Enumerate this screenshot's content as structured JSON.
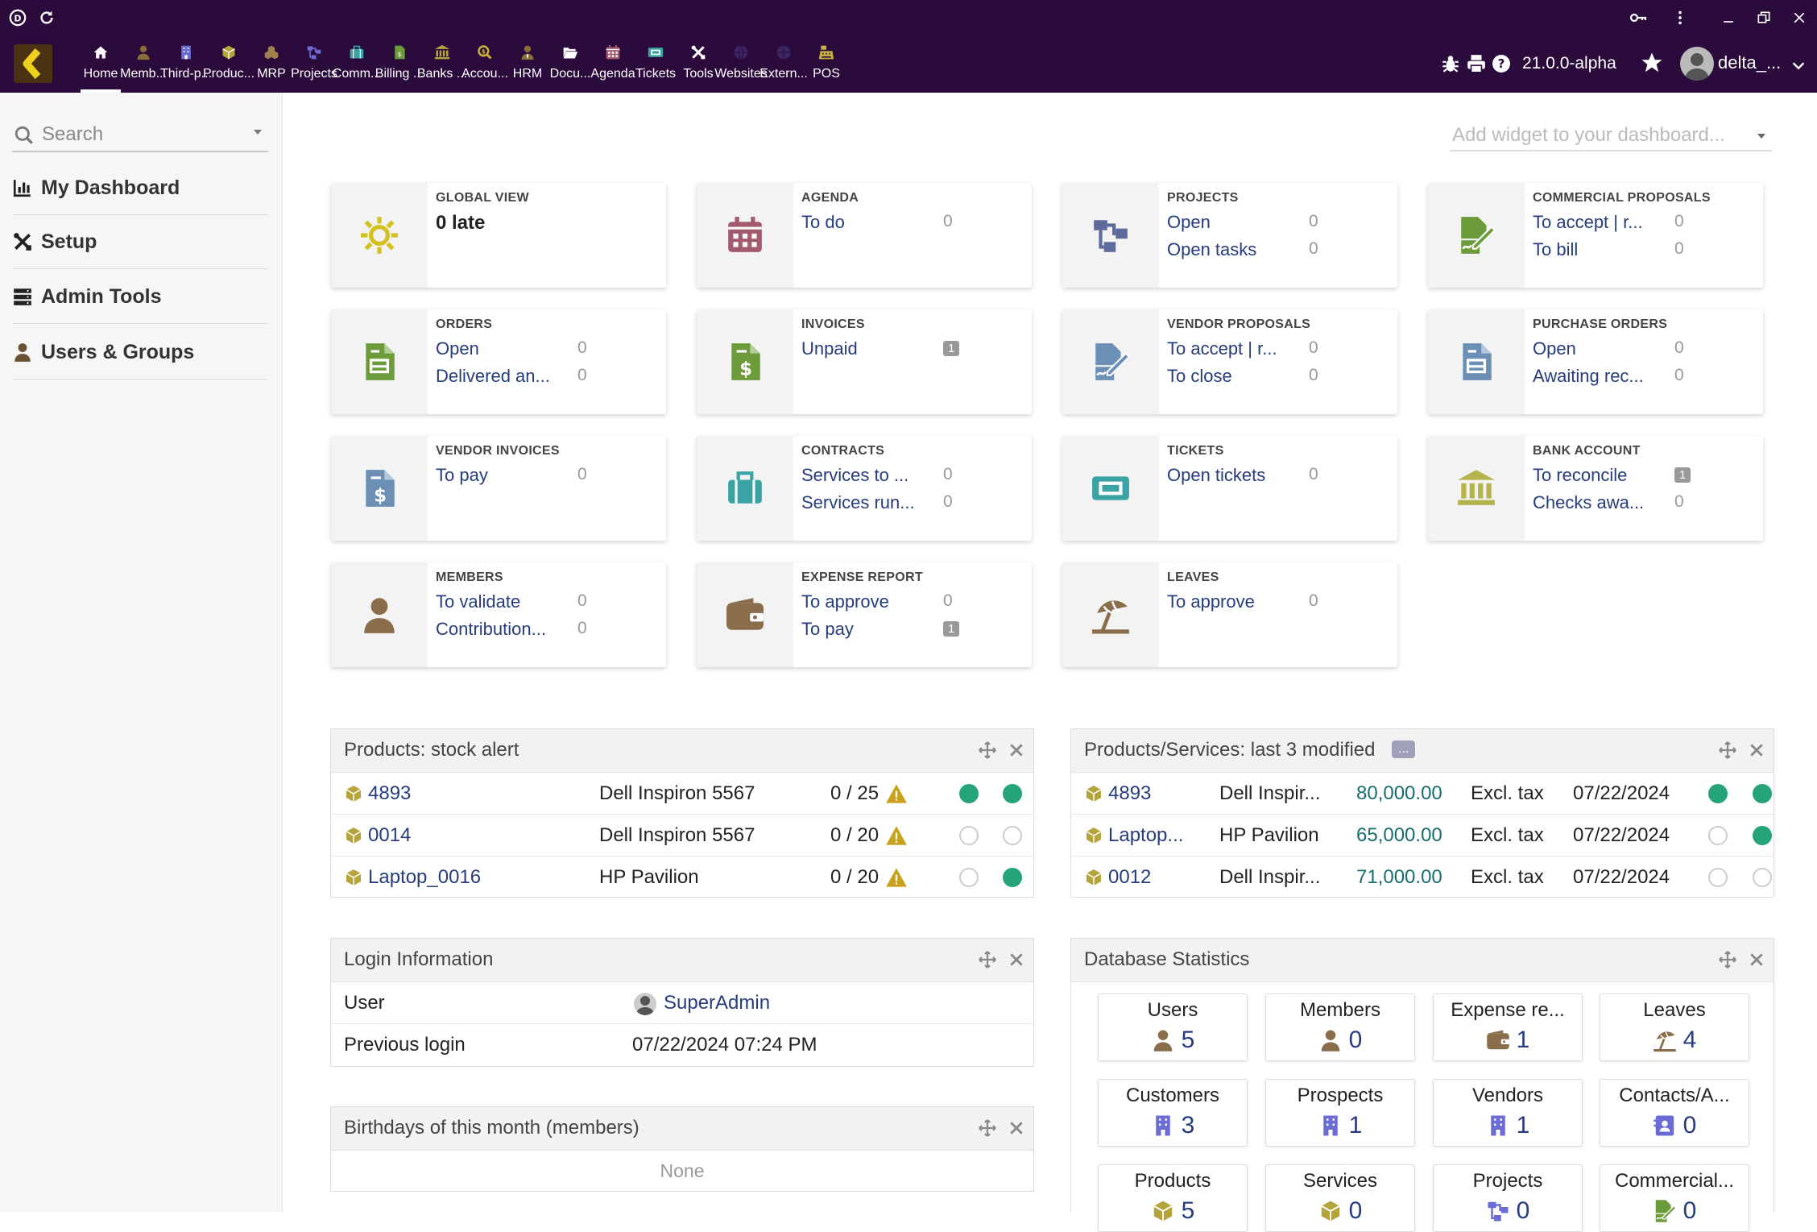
{
  "topbar": {
    "version": "21.0.0-alpha",
    "username": "delta_...",
    "menu": [
      {
        "label": "Home",
        "icon": "home-icon",
        "color": "#ffffff"
      },
      {
        "label": "Memb...",
        "icon": "member-icon",
        "color": "#8a6d3b"
      },
      {
        "label": "Third-p...",
        "icon": "building-icon",
        "color": "#6b6bd6"
      },
      {
        "label": "Produc...",
        "icon": "cube-icon",
        "color": "#b5a33b"
      },
      {
        "label": "MRP",
        "icon": "cubes-icon",
        "color": "#a0804c"
      },
      {
        "label": "Projects",
        "icon": "sitemap-icon",
        "color": "#6b6bd6"
      },
      {
        "label": "Comm...",
        "icon": "suitcase-icon",
        "color": "#3aa3a3"
      },
      {
        "label": "Billing ...",
        "icon": "invoice-icon",
        "color": "#6b9b3b"
      },
      {
        "label": "Banks ...",
        "icon": "bank-icon",
        "color": "#b5a33b"
      },
      {
        "label": "Accou...",
        "icon": "search-dollar-icon",
        "color": "#c9b23b"
      },
      {
        "label": "HRM",
        "icon": "user-tie-icon",
        "color": "#8a6d3b"
      },
      {
        "label": "Docu...",
        "icon": "folder-open-icon",
        "color": "#ffffff"
      },
      {
        "label": "Agenda",
        "icon": "calendar-icon",
        "color": "#a15a6e"
      },
      {
        "label": "Tickets",
        "icon": "ticket-icon",
        "color": "#3aa3a3"
      },
      {
        "label": "Tools",
        "icon": "tools-icon",
        "color": "#ffffff"
      },
      {
        "label": "Websites",
        "icon": "globe-icon",
        "color": "#3d2566"
      },
      {
        "label": "Extern...",
        "icon": "globe-alt-icon",
        "color": "#3d2566"
      },
      {
        "label": "POS",
        "icon": "cash-register-icon",
        "color": "#c9b23b"
      }
    ]
  },
  "sidebar": {
    "search_placeholder": "Search",
    "items": [
      {
        "label": "My Dashboard",
        "icon": "chart-bar-icon"
      },
      {
        "label": "Setup",
        "icon": "tools-icon"
      },
      {
        "label": "Admin Tools",
        "icon": "server-icon"
      },
      {
        "label": "Users & Groups",
        "icon": "user-icon"
      }
    ]
  },
  "dashboard": {
    "widget_placeholder": "Add widget to your dashboard...",
    "cards": [
      {
        "title": "GLOBAL VIEW",
        "big": "0 late",
        "icon": "sun-icon",
        "color": "#d4c11f",
        "rows": []
      },
      {
        "title": "AGENDA",
        "icon": "calendar-icon",
        "color": "#a15a6e",
        "rows": [
          {
            "label": "To do",
            "value": "0"
          }
        ]
      },
      {
        "title": "PROJECTS",
        "icon": "sitemap-icon",
        "color": "#5f6a9c",
        "rows": [
          {
            "label": "Open",
            "value": "0"
          },
          {
            "label": "Open tasks",
            "value": "0"
          }
        ]
      },
      {
        "title": "COMMERCIAL PROPOSALS",
        "icon": "signature-icon",
        "color": "#6b9b3b",
        "rows": [
          {
            "label": "To accept | r...",
            "value": "0"
          },
          {
            "label": "To bill",
            "value": "0"
          }
        ]
      },
      {
        "title": "ORDERS",
        "icon": "file-order-icon",
        "color": "#6b9b3b",
        "rows": [
          {
            "label": "Open",
            "value": "0"
          },
          {
            "label": "Delivered an...",
            "value": "0"
          }
        ]
      },
      {
        "title": "INVOICES",
        "icon": "file-dollar-icon",
        "color": "#6b9b3b",
        "rows": [
          {
            "label": "Unpaid",
            "value": "1",
            "badge": true
          }
        ]
      },
      {
        "title": "VENDOR PROPOSALS",
        "icon": "signature-icon",
        "color": "#6b8fb5",
        "rows": [
          {
            "label": "To accept | r...",
            "value": "0"
          },
          {
            "label": "To close",
            "value": "0"
          }
        ]
      },
      {
        "title": "PURCHASE ORDERS",
        "icon": "file-order-icon",
        "color": "#6b8fb5",
        "rows": [
          {
            "label": "Open",
            "value": "0"
          },
          {
            "label": "Awaiting rec...",
            "value": "0"
          }
        ]
      },
      {
        "title": "VENDOR INVOICES",
        "icon": "file-dollar-icon",
        "color": "#6b8fb5",
        "rows": [
          {
            "label": "To pay",
            "value": "0"
          }
        ]
      },
      {
        "title": "CONTRACTS",
        "icon": "suitcase-icon",
        "color": "#3aa3a3",
        "rows": [
          {
            "label": "Services to ...",
            "value": "0"
          },
          {
            "label": "Services run...",
            "value": "0"
          }
        ]
      },
      {
        "title": "TICKETS",
        "icon": "ticket-icon",
        "color": "#3aa3a3",
        "rows": [
          {
            "label": "Open tickets",
            "value": "0"
          }
        ]
      },
      {
        "title": "BANK ACCOUNT",
        "icon": "bank-icon",
        "color": "#b5b34b",
        "rows": [
          {
            "label": "To reconcile",
            "value": "1",
            "badge": true
          },
          {
            "label": "Checks awa...",
            "value": "0"
          }
        ]
      },
      {
        "title": "MEMBERS",
        "icon": "user-icon",
        "color": "#8a6d4b",
        "rows": [
          {
            "label": "To validate",
            "value": "0"
          },
          {
            "label": "Contribution...",
            "value": "0"
          }
        ]
      },
      {
        "title": "EXPENSE REPORT",
        "icon": "wallet-icon",
        "color": "#8a6d4b",
        "rows": [
          {
            "label": "To approve",
            "value": "0"
          },
          {
            "label": "To pay",
            "value": "1",
            "badge": true
          }
        ]
      },
      {
        "title": "LEAVES",
        "icon": "umbrella-beach-icon",
        "color": "#8a6d4b",
        "rows": [
          {
            "label": "To approve",
            "value": "0"
          }
        ]
      }
    ]
  },
  "stock_alert": {
    "title": "Products: stock alert",
    "rows": [
      {
        "ref": "4893",
        "name": "Dell Inspiron 5567",
        "stock": "0 / 25",
        "sell": true,
        "buy": true
      },
      {
        "ref": "0014",
        "name": "Dell Inspiron 5567",
        "stock": "0 / 20",
        "sell": false,
        "buy": false
      },
      {
        "ref": "Laptop_0016",
        "name": "HP Pavilion",
        "stock": "0 / 20",
        "sell": false,
        "buy": true
      }
    ]
  },
  "last_modified": {
    "title": "Products/Services: last 3 modified",
    "more": "...",
    "rows": [
      {
        "ref": "4893",
        "name": "Dell Inspir...",
        "price": "80,000.00",
        "tax": "Excl. tax",
        "date": "07/22/2024",
        "sell": true,
        "buy": true
      },
      {
        "ref": "Laptop...",
        "name": "HP Pavilion",
        "price": "65,000.00",
        "tax": "Excl. tax",
        "date": "07/22/2024",
        "sell": false,
        "buy": true
      },
      {
        "ref": "0012",
        "name": "Dell Inspir...",
        "price": "71,000.00",
        "tax": "Excl. tax",
        "date": "07/22/2024",
        "sell": false,
        "buy": false
      }
    ]
  },
  "login_info": {
    "title": "Login Information",
    "user_label": "User",
    "user_value": "SuperAdmin",
    "prev_label": "Previous login",
    "prev_value": "07/22/2024 07:24 PM"
  },
  "birthdays": {
    "title": "Birthdays of this month (members)",
    "empty": "None"
  },
  "db_stats": {
    "title": "Database Statistics",
    "items": [
      {
        "label": "Users",
        "value": "5",
        "icon": "user-icon",
        "color": "#8a6d4b"
      },
      {
        "label": "Members",
        "value": "0",
        "icon": "user-icon",
        "color": "#8a6d4b"
      },
      {
        "label": "Expense re...",
        "value": "1",
        "icon": "wallet-icon",
        "color": "#8a6d4b"
      },
      {
        "label": "Leaves",
        "value": "4",
        "icon": "umbrella-beach-icon",
        "color": "#8a6d4b"
      },
      {
        "label": "Customers",
        "value": "3",
        "icon": "building-icon",
        "color": "#6b6bd6"
      },
      {
        "label": "Prospects",
        "value": "1",
        "icon": "building-icon",
        "color": "#6b6bd6"
      },
      {
        "label": "Vendors",
        "value": "1",
        "icon": "building-icon",
        "color": "#6b6bd6"
      },
      {
        "label": "Contacts/A...",
        "value": "0",
        "icon": "address-card-icon",
        "color": "#6b6bd6"
      },
      {
        "label": "Products",
        "value": "5",
        "icon": "cube-icon",
        "color": "#b5a33b"
      },
      {
        "label": "Services",
        "value": "0",
        "icon": "cube-icon",
        "color": "#b5a33b"
      },
      {
        "label": "Projects",
        "value": "0",
        "icon": "sitemap-icon",
        "color": "#6b6bd6"
      },
      {
        "label": "Commercial...",
        "value": "0",
        "icon": "signature-icon",
        "color": "#6b9b3b"
      }
    ]
  }
}
